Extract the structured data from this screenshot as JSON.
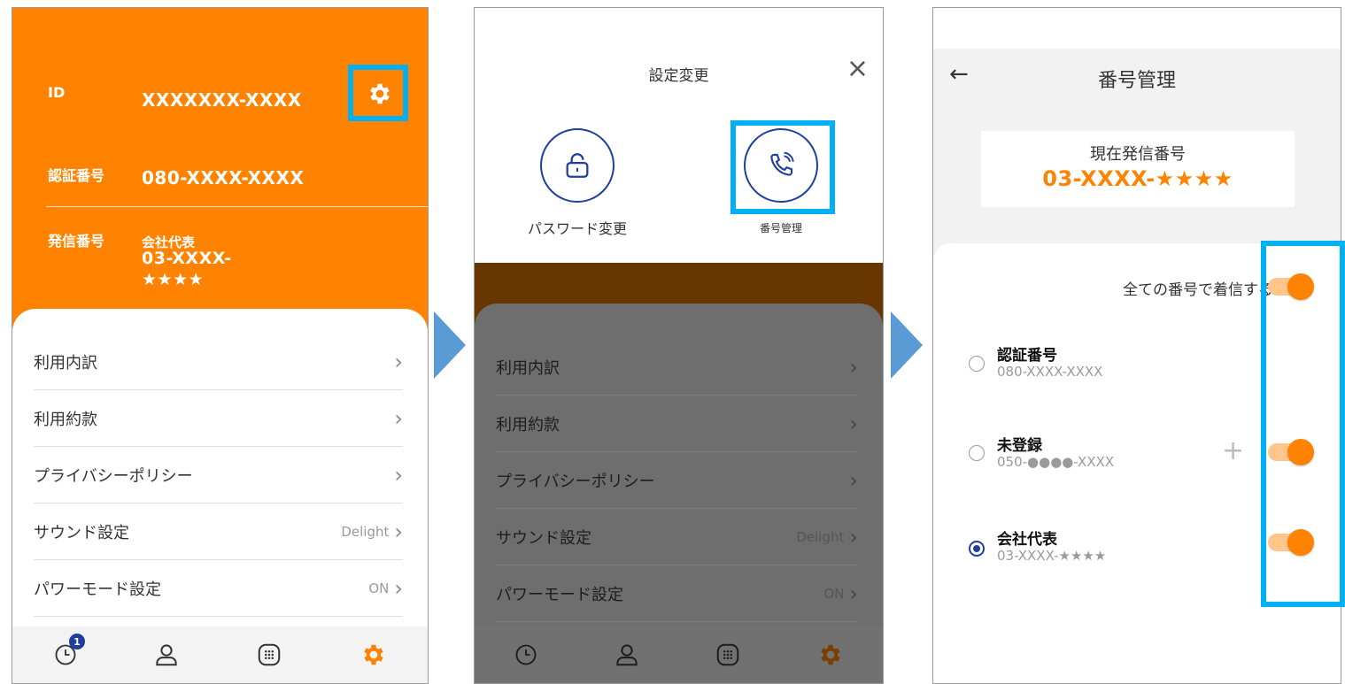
{
  "screen1": {
    "id_label": "ID",
    "id_value": "XXXXXXX-XXXX",
    "auth_label": "認証番号",
    "auth_value": "080-XXXX-XXXX",
    "caller_label": "発信番号",
    "caller_name": "会社代表",
    "caller_number_line1": "03-XXXX-",
    "caller_number_line2": "★★★★",
    "menu": [
      {
        "label": "利用内訳",
        "value": ""
      },
      {
        "label": "利用約款",
        "value": ""
      },
      {
        "label": "プライバシーポリシー",
        "value": ""
      },
      {
        "label": "サウンド設定",
        "value": "Delight"
      },
      {
        "label": "パワーモード設定",
        "value": "ON"
      }
    ],
    "history_badge": "1",
    "chevron": "›"
  },
  "screen2": {
    "modal_title": "設定変更",
    "close": "×",
    "password_label": "パスワード変更",
    "number_label": "番号管理",
    "menu": [
      {
        "label": "利用内訳",
        "value": ""
      },
      {
        "label": "利用約款",
        "value": ""
      },
      {
        "label": "プライバシーポリシー",
        "value": ""
      },
      {
        "label": "サウンド設定",
        "value": "Delight"
      },
      {
        "label": "パワーモード設定",
        "value": "ON"
      }
    ]
  },
  "screen3": {
    "back": "←",
    "title": "番号管理",
    "current_label": "現在発信番号",
    "current_number": "03-XXXX-★★★★",
    "all_numbers_label": "全ての番号で着信する",
    "options": [
      {
        "title": "認証番号",
        "number": "080-XXXX-XXXX",
        "selected": false
      },
      {
        "title": "未登録",
        "number": "050-●●●●-XXXX",
        "selected": false
      },
      {
        "title": "会社代表",
        "number": "03-XXXX-★★★★",
        "selected": true
      }
    ],
    "plus": "+"
  },
  "colors": {
    "brand_orange": "#ff8300",
    "highlight": "#00b0f0",
    "arrow": "#5b9bd5",
    "accent_blue": "#1f3f9f"
  }
}
